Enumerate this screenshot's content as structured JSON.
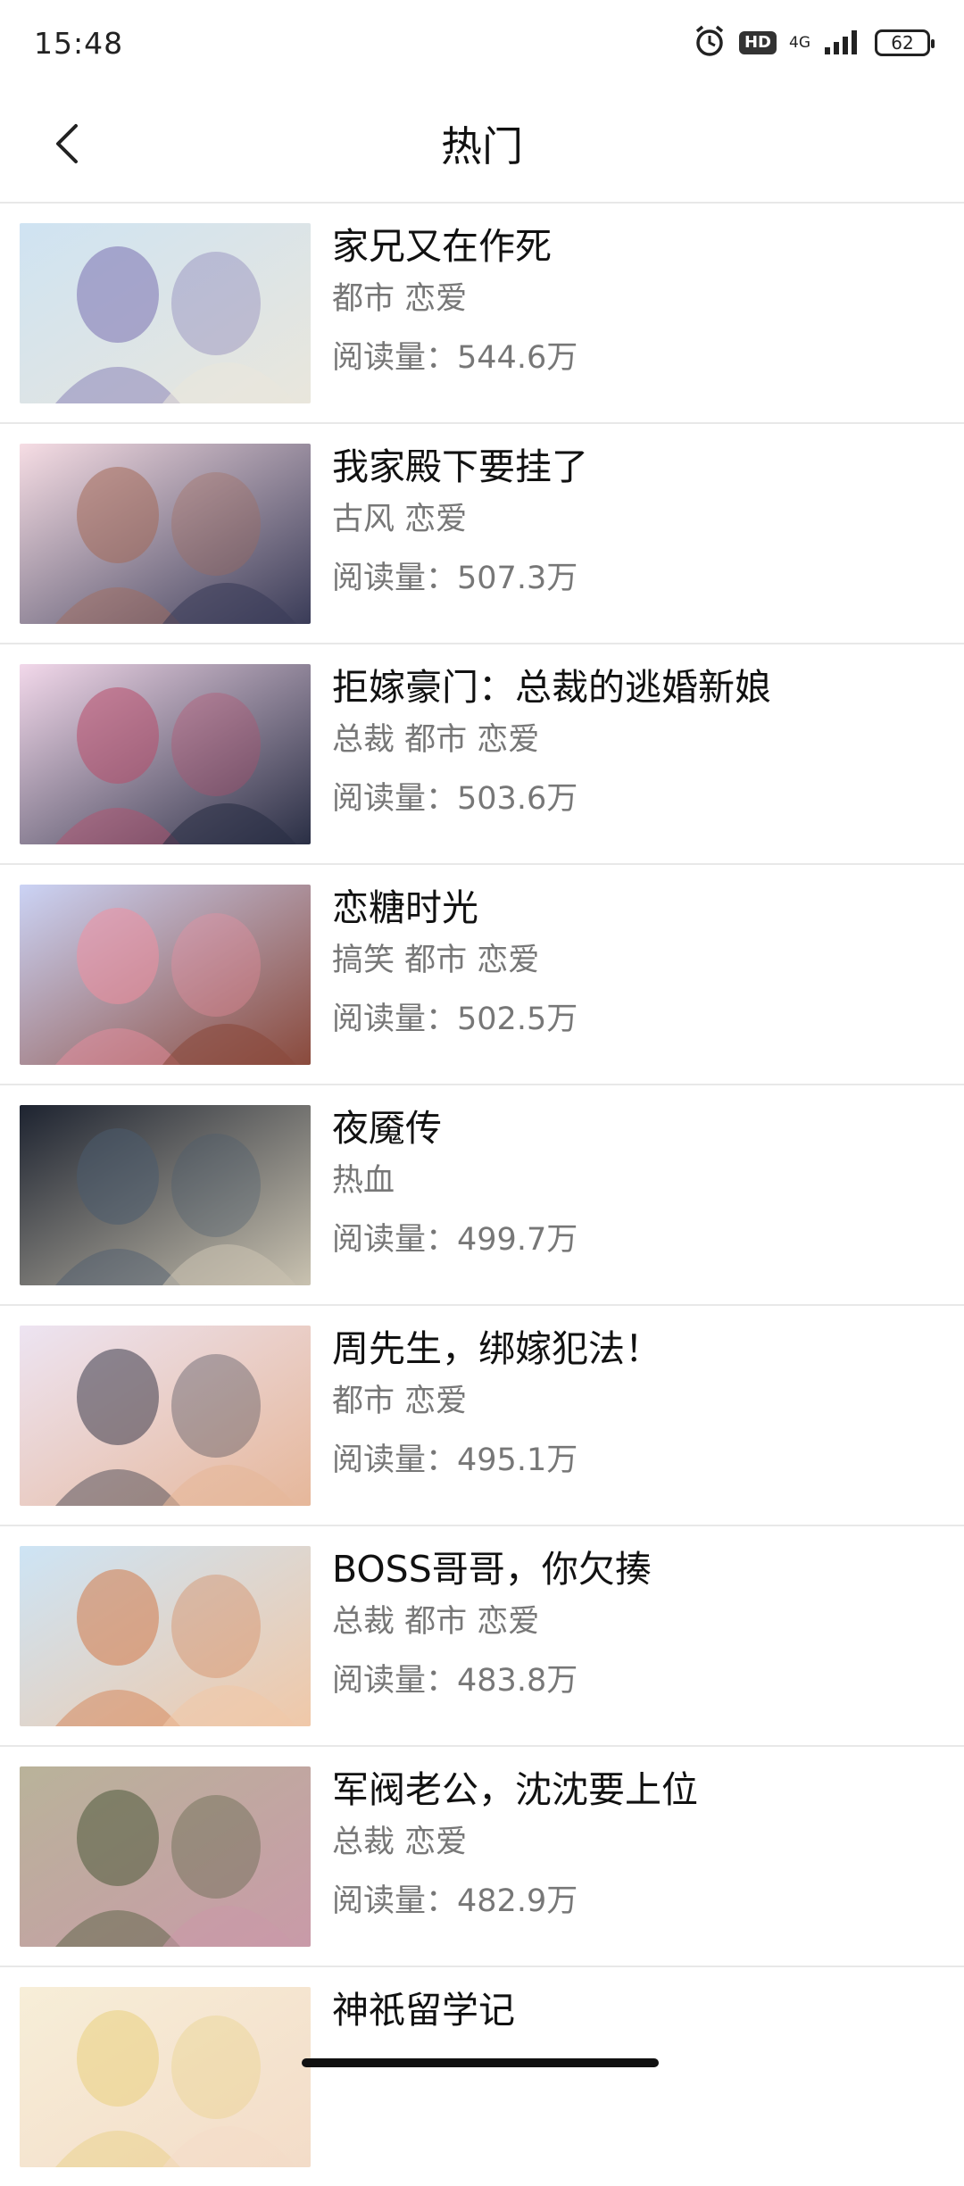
{
  "status_bar": {
    "time": "15:48",
    "hd": "HD",
    "network": "4G",
    "battery": "62"
  },
  "header": {
    "title": "热门"
  },
  "comics": [
    {
      "title": "家兄又在作死",
      "tags": "都市 恋爱",
      "reads_label": "阅读量：",
      "reads": "544.6万",
      "cover_colors": [
        "#cfe3f2",
        "#7a6fb0",
        "#e9e6dc"
      ]
    },
    {
      "title": "我家殿下要挂了",
      "tags": "古风 恋爱",
      "reads_label": "阅读量：",
      "reads": "507.3万",
      "cover_colors": [
        "#f6dde4",
        "#a46a58",
        "#3a3c58"
      ]
    },
    {
      "title": "拒嫁豪门：总裁的逃婚新娘",
      "tags": "总裁 都市 恋爱",
      "reads_label": "阅读量：",
      "reads": "503.6万",
      "cover_colors": [
        "#f2d8ea",
        "#b84d6a",
        "#2a2f45"
      ]
    },
    {
      "title": "恋糖时光",
      "tags": "搞笑 都市 恋爱",
      "reads_label": "阅读量：",
      "reads": "502.5万",
      "cover_colors": [
        "#cbd3f5",
        "#f08fa0",
        "#8a4a3c"
      ]
    },
    {
      "title": "夜魇传",
      "tags": "热血",
      "reads_label": "阅读量：",
      "reads": "499.7万",
      "cover_colors": [
        "#1d2330",
        "#4b5b6e",
        "#c9c2b0"
      ]
    },
    {
      "title": "周先生，绑嫁犯法！",
      "tags": "都市 恋爱",
      "reads_label": "阅读量：",
      "reads": "495.1万",
      "cover_colors": [
        "#ede4f2",
        "#3a3b4a",
        "#e6b79a"
      ]
    },
    {
      "title": "BOSS哥哥，你欠揍",
      "tags": "总裁 都市 恋爱",
      "reads_label": "阅读量：",
      "reads": "483.8万",
      "cover_colors": [
        "#cde4f5",
        "#d27a4a",
        "#f0c8a8"
      ]
    },
    {
      "title": "军阀老公，沈沈要上位",
      "tags": "总裁 恋爱",
      "reads_label": "阅读量：",
      "reads": "482.9万",
      "cover_colors": [
        "#b9b39a",
        "#4d5a3a",
        "#c99aa8"
      ]
    },
    {
      "title": "神祇留学记",
      "tags": "",
      "reads_label": "",
      "reads": "",
      "cover_colors": [
        "#f7eed8",
        "#e9cf7e",
        "#f3dcc8"
      ]
    }
  ]
}
